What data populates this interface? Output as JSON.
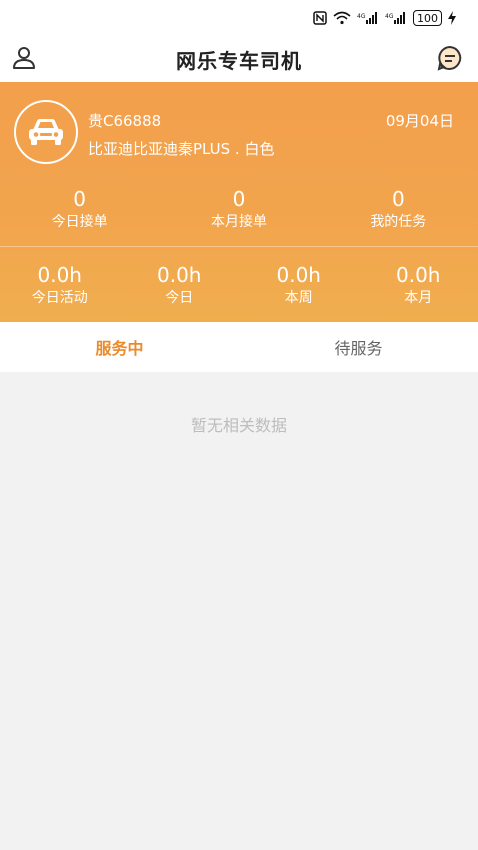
{
  "status_bar": {
    "nfc": "N",
    "wifi": "wifi-icon",
    "signal1": "4G",
    "signal2": "4G",
    "battery": "100"
  },
  "header": {
    "title": "网乐专车司机",
    "left_icon": "user-icon",
    "right_icon": "message-icon"
  },
  "driver": {
    "plate": "贵C66888",
    "vehicle": "比亚迪比亚迪秦PLUS . 白色",
    "date": "09月04日"
  },
  "stats_orders": [
    {
      "value": "0",
      "label": "今日接单"
    },
    {
      "value": "0",
      "label": "本月接单"
    },
    {
      "value": "0",
      "label": "我的任务"
    }
  ],
  "stats_hours": [
    {
      "value": "0.0h",
      "label": "今日活动"
    },
    {
      "value": "0.0h",
      "label": "今日"
    },
    {
      "value": "0.0h",
      "label": "本周"
    },
    {
      "value": "0.0h",
      "label": "本月"
    }
  ],
  "tabs": [
    {
      "label": "服务中",
      "active": true
    },
    {
      "label": "待服务",
      "active": false
    }
  ],
  "empty_text": "暂无相关数据",
  "colors": {
    "accent": "#ec8a2a",
    "card_top": "#f39f4c",
    "card_bottom": "#f0ae4f"
  }
}
